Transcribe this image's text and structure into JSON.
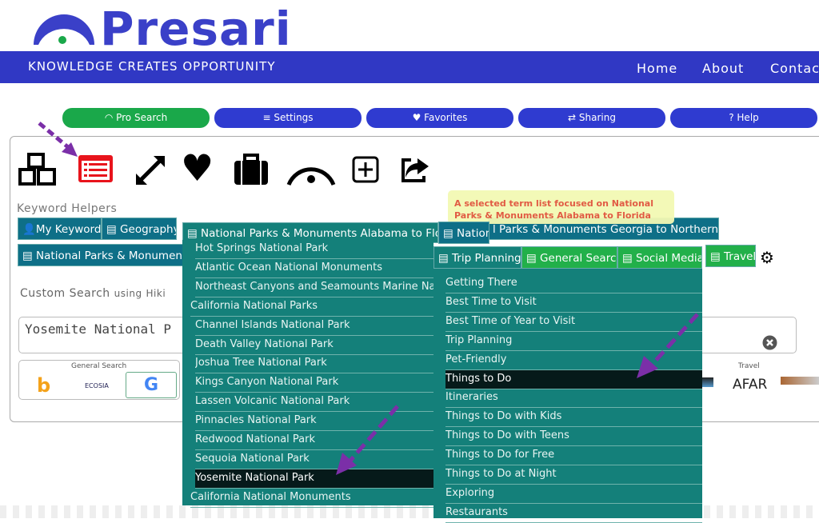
{
  "header": {
    "brand": "Presari",
    "tagline": "KNOWLEDGE CREATES OPPORTUNITY",
    "nav": [
      "Home",
      "About",
      "Contac"
    ]
  },
  "buttons": [
    {
      "label": "Pro Search",
      "icon": "arc-icon"
    },
    {
      "label": "Settings",
      "icon": "sliders-icon"
    },
    {
      "label": "Favorites",
      "icon": "heart-icon"
    },
    {
      "label": "Sharing",
      "icon": "exchange-icon"
    },
    {
      "label": "Help",
      "icon": "question-icon"
    }
  ],
  "colors": {
    "blue": "#3038c4",
    "green": "#22b04a",
    "teal": "#14807a",
    "tab": "#0e6f87",
    "highlight": "#061a1a",
    "arrow": "#7b2fa8"
  },
  "keyword_helpers": {
    "title": "Keyword Helpers",
    "tabs": [
      "My Keywords",
      "Geography",
      "National Parks & Monuments Alabama to Florida",
      "Nation",
      "l Parks & Monuments Georgia to Northern Mar",
      "National Parks & Monuments ("
    ]
  },
  "tooltip": "A selected term list focused on National Parks & Monuments Alabama to Florida",
  "parks_list": [
    "Hot Springs National Park",
    "Atlantic Ocean National Monuments",
    "Northeast Canyons and Seamounts Marine Nation",
    "California National Parks",
    "Channel Islands National Park",
    "Death Valley National Park",
    "Joshua Tree National Park",
    "Kings Canyon National Park",
    "Lassen Volcanic National Park",
    "Pinnacles National Park",
    "Redwood National Park",
    "Sequoia National Park",
    "Yosemite National Park",
    "California National Monuments"
  ],
  "topic_tabs": [
    "Trip Planning",
    "General Search",
    "Social Media",
    "Travel"
  ],
  "topic_list": [
    "Getting There",
    "Best Time to Visit",
    "Best Time of Year to Visit",
    "Trip Planning",
    "Pet-Friendly",
    "Things to Do",
    "Itineraries",
    "Things to Do with Kids",
    "Things to Do with Teens",
    "Things to Do for Free",
    "Things to Do at Night",
    "Exploring",
    "Restaurants"
  ],
  "custom_search": {
    "title": "Custom Search",
    "using": "using",
    "link": "Hiki",
    "value": "Yosemite National P"
  },
  "engines": {
    "general_label": "General Search",
    "travel_label": "Travel",
    "afar": "AFAR",
    "ecosia": "ECOSIA"
  }
}
